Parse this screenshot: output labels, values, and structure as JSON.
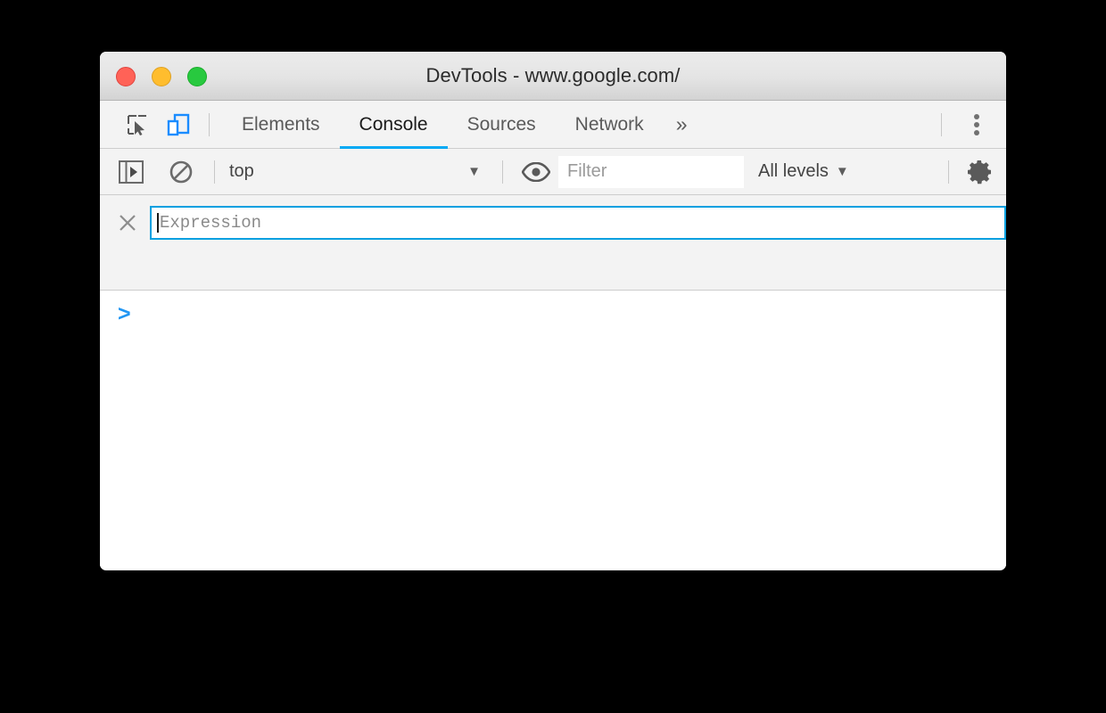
{
  "window": {
    "title": "DevTools - www.google.com/",
    "traffic_lights": [
      {
        "name": "close",
        "color": "#ff6257"
      },
      {
        "name": "minimize",
        "color": "#ffbd2e"
      },
      {
        "name": "maximize",
        "color": "#28c93f"
      }
    ]
  },
  "tabbar": {
    "inspect_icon": "inspect-element-icon",
    "device_icon": "device-toolbar-icon",
    "tabs": [
      {
        "label": "Elements",
        "active": false
      },
      {
        "label": "Console",
        "active": true
      },
      {
        "label": "Sources",
        "active": false
      },
      {
        "label": "Network",
        "active": false
      }
    ],
    "more_tabs": "»",
    "kebab_icon": "more-options-icon",
    "active_tab_underline_color": "#03a9f4",
    "device_icon_color": "#1a8cff"
  },
  "console_toolbar": {
    "sidebar_toggle_icon": "console-sidebar-icon",
    "clear_icon": "clear-console-icon",
    "context": {
      "value": "top",
      "caret": "▼"
    },
    "eye_icon": "live-expression-eye-icon",
    "filter": {
      "value": "",
      "placeholder": "Filter"
    },
    "levels": {
      "value": "All levels",
      "caret": "▼"
    },
    "settings_icon": "settings-gear-icon"
  },
  "live_expression": {
    "remove_icon": "close-icon",
    "input_value": "",
    "placeholder": "Expression",
    "border_color": "#03a0e0"
  },
  "console": {
    "prompt": ">",
    "prompt_color": "#2196f3",
    "input_value": ""
  }
}
